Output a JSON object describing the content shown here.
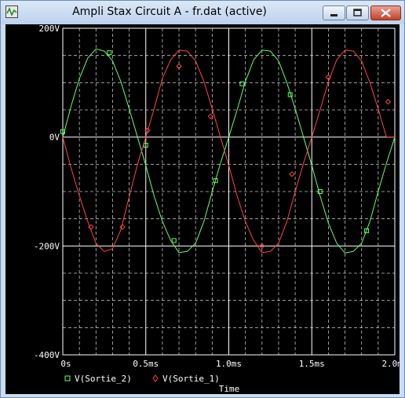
{
  "window": {
    "title": "Ampli Stax Circuit A - fr.dat (active)",
    "icon": "probe-app-icon",
    "buttons": {
      "minimize": "minimize-icon",
      "maximize": "maximize-icon",
      "close": "close-icon"
    }
  },
  "colors": {
    "background": "#000000",
    "grid": "#ffffff",
    "sortie_2": "#66ff66",
    "sortie_1": "#ff4444"
  },
  "chart_data": {
    "type": "line",
    "xlabel": "Time",
    "ylabel": "",
    "x_ticks": [
      "0s",
      "0.5ms",
      "1.0ms",
      "1.5ms",
      "2.0ms"
    ],
    "y_ticks": [
      "200V",
      "0V",
      "-200V",
      "-400V"
    ],
    "xlim": [
      0,
      2.0
    ],
    "x_unit": "ms",
    "ylim": [
      -400,
      200
    ],
    "y_unit": "V",
    "grid": true,
    "series": [
      {
        "name": "V(Sortie_2)",
        "marker": "square",
        "color": "#66ff66",
        "x": [
          0,
          0.05,
          0.1,
          0.15,
          0.2,
          0.25,
          0.3,
          0.35,
          0.4,
          0.45,
          0.5,
          0.55,
          0.6,
          0.65,
          0.7,
          0.75,
          0.8,
          0.85,
          0.9,
          0.95,
          1.0,
          1.05,
          1.1,
          1.15,
          1.2,
          1.25,
          1.3,
          1.35,
          1.4,
          1.45,
          1.5,
          1.55,
          1.6,
          1.65,
          1.7,
          1.75,
          1.8,
          1.85,
          1.9,
          1.95,
          2.0
        ],
        "y": [
          0,
          57,
          108,
          145,
          162,
          158,
          140,
          102,
          52,
          0,
          -52,
          -108,
          -155,
          -190,
          -212,
          -210,
          -195,
          -155,
          -100,
          -48,
          0,
          50,
          102,
          142,
          160,
          158,
          140,
          100,
          52,
          0,
          -52,
          -108,
          -158,
          -195,
          -213,
          -210,
          -195,
          -155,
          -100,
          -48,
          0
        ],
        "markers_x": [
          0.0,
          0.28,
          0.5,
          0.67,
          0.92,
          1.08,
          1.37,
          1.55,
          1.83
        ],
        "markers_y": [
          10,
          155,
          -15,
          -190,
          -80,
          98,
          78,
          -100,
          -172
        ]
      },
      {
        "name": "V(Sortie_1)",
        "marker": "diamond",
        "color": "#ff4444",
        "x": [
          0,
          0.05,
          0.1,
          0.15,
          0.2,
          0.25,
          0.3,
          0.35,
          0.4,
          0.45,
          0.5,
          0.55,
          0.6,
          0.65,
          0.7,
          0.75,
          0.8,
          0.85,
          0.9,
          0.95,
          1.0,
          1.05,
          1.1,
          1.15,
          1.2,
          1.25,
          1.3,
          1.35,
          1.4,
          1.45,
          1.5,
          1.55,
          1.6,
          1.65,
          1.7,
          1.75,
          1.8,
          1.85,
          1.9,
          1.95,
          2.0
        ],
        "y": [
          0,
          -57,
          -108,
          -155,
          -195,
          -210,
          -205,
          -170,
          -110,
          -50,
          0,
          52,
          108,
          142,
          160,
          158,
          140,
          102,
          52,
          0,
          -52,
          -108,
          -155,
          -190,
          -212,
          -210,
          -195,
          -155,
          -100,
          -48,
          0,
          50,
          102,
          142,
          160,
          158,
          140,
          100,
          52,
          0,
          0
        ],
        "markers_x": [
          0.17,
          0.36,
          0.51,
          0.7,
          0.89,
          1.2,
          1.38,
          1.6,
          1.96
        ],
        "markers_y": [
          -165,
          -165,
          12,
          130,
          38,
          -200,
          -68,
          110,
          65
        ]
      }
    ]
  }
}
